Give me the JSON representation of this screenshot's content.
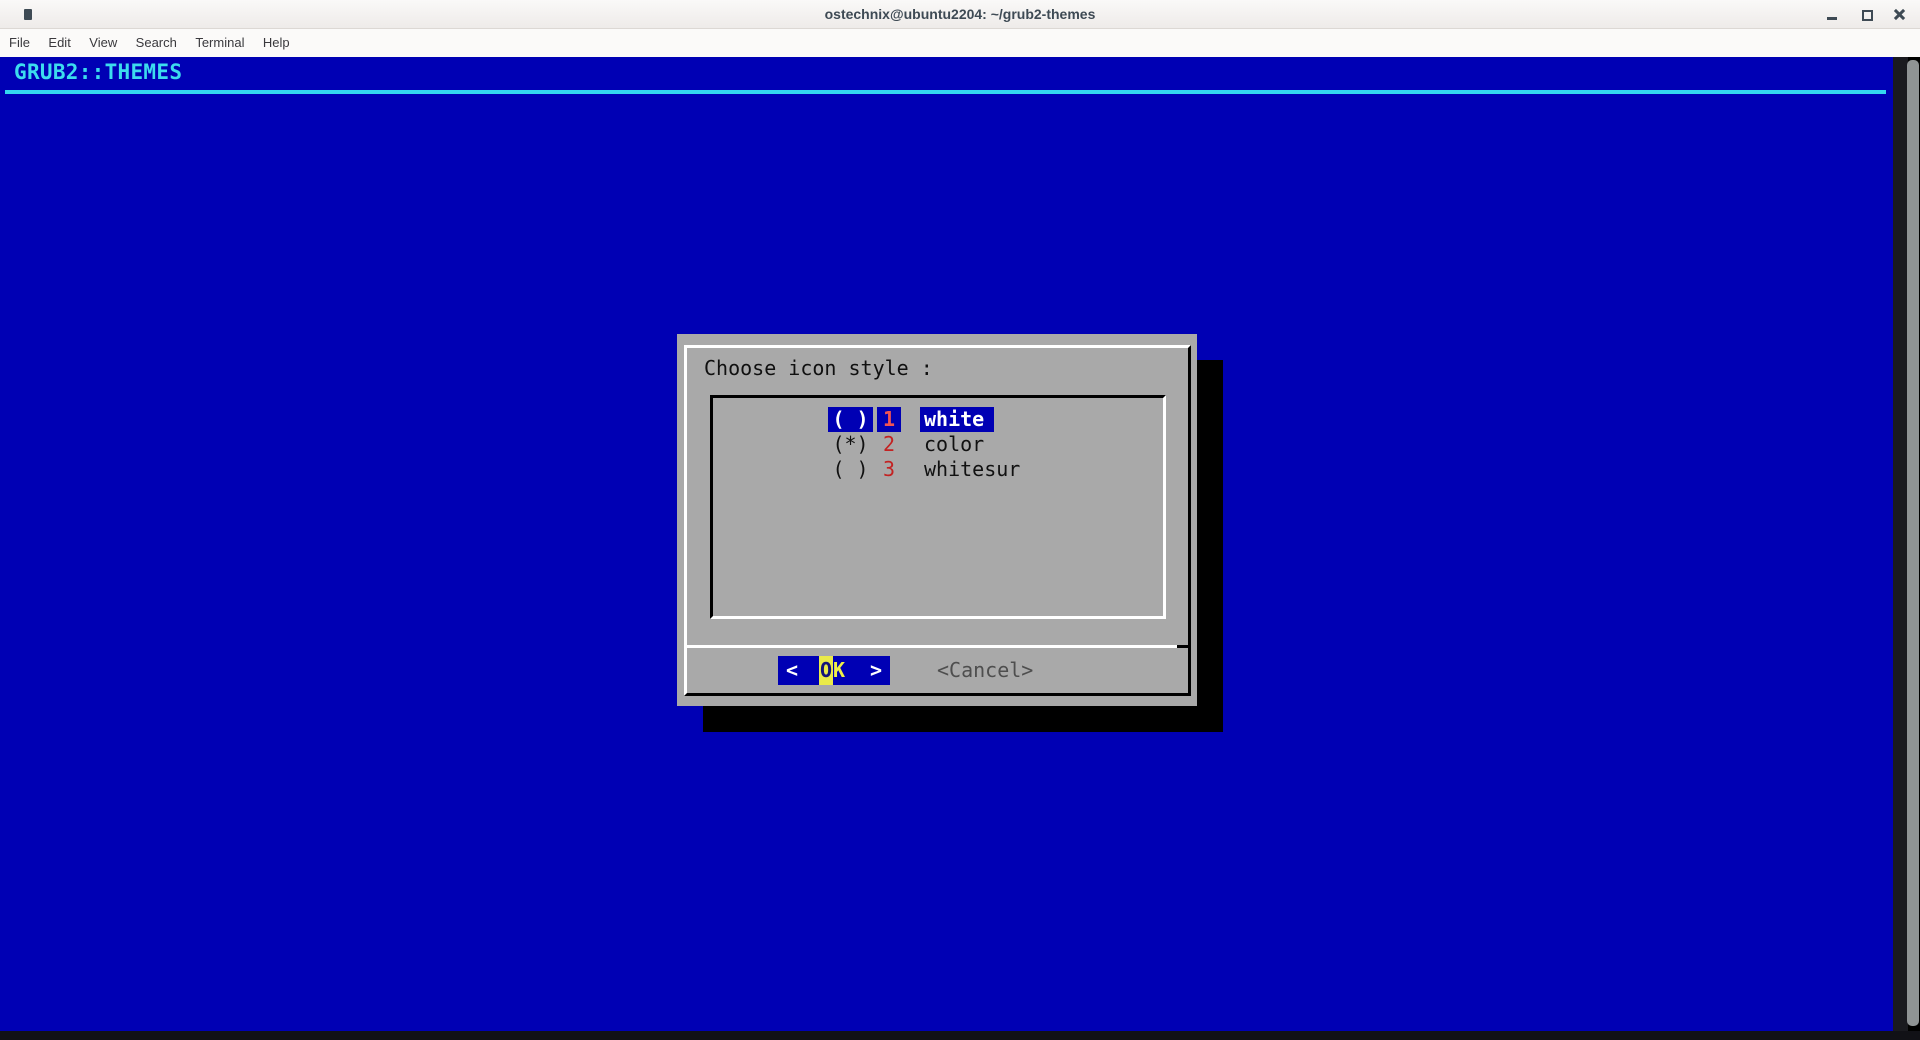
{
  "titlebar": {
    "title": "ostechnix@ubuntu2204: ~/grub2-themes"
  },
  "menubar": {
    "items": [
      "File",
      "Edit",
      "View",
      "Search",
      "Terminal",
      "Help"
    ]
  },
  "terminal": {
    "header": "GRUB2::THEMES",
    "dialog": {
      "title": "Choose icon style :",
      "items": [
        {
          "radio": "( )",
          "tag": "1",
          "label": "white",
          "selected": false,
          "focused": true
        },
        {
          "radio": "(*)",
          "tag": "2",
          "label": "color",
          "selected": true,
          "focused": false
        },
        {
          "radio": "( )",
          "tag": "3",
          "label": "whitesur",
          "selected": false,
          "focused": false
        }
      ],
      "buttons": {
        "ok": {
          "left": "<",
          "hotkey": "O",
          "rest": "K",
          "right": ">"
        },
        "cancel": "<Cancel>"
      }
    }
  },
  "colors": {
    "terminal_blue": "#0000b4",
    "dialog_gray": "#a9a9a9",
    "header_cyan": "#3cdcee",
    "tag_red": "#c32222",
    "tag_red_bright": "#f05454",
    "cursor_yellow": "#eaea49",
    "hotkey_yellow": "#f0f048",
    "shadow_black": "#000000"
  }
}
